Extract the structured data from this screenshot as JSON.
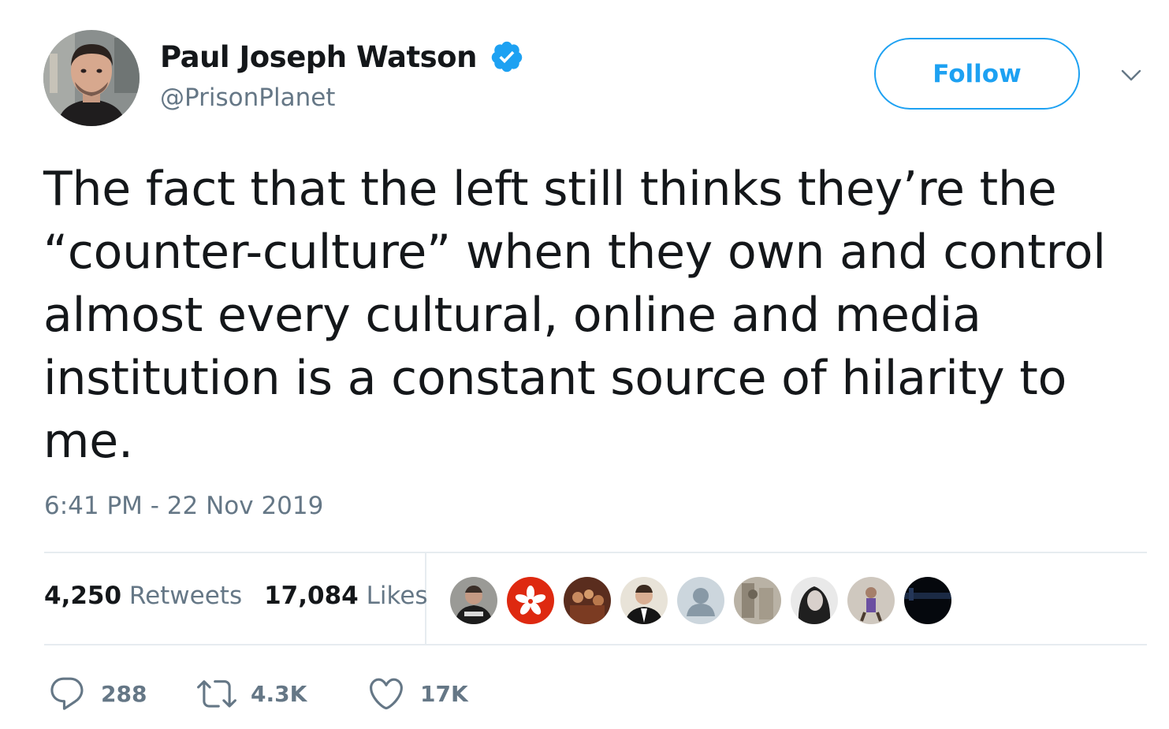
{
  "author": {
    "display_name": "Paul Joseph Watson",
    "handle": "@PrisonPlanet",
    "verified": true
  },
  "follow_label": "Follow",
  "tweet": {
    "text": "The fact that the left still thinks they’re the “counter-culture” when they own and control almost every cultural, online and media institution is a constant source of hilarity to me.",
    "timestamp": "6:41 PM - 22 Nov 2019"
  },
  "stats": {
    "retweets_count": "4,250",
    "retweets_label": "Retweets",
    "likes_count": "17,084",
    "likes_label": "Likes"
  },
  "actions": {
    "replies": "288",
    "retweets": "4.3K",
    "likes": "17K"
  },
  "icons": {
    "verified": "verified-badge-icon",
    "caret": "chevron-down-icon",
    "reply": "reply-icon",
    "retweet": "retweet-icon",
    "like": "heart-icon"
  },
  "colors": {
    "accent": "#1da1f2",
    "text": "#14171a",
    "muted": "#657786",
    "divider": "#e6ecf0"
  }
}
